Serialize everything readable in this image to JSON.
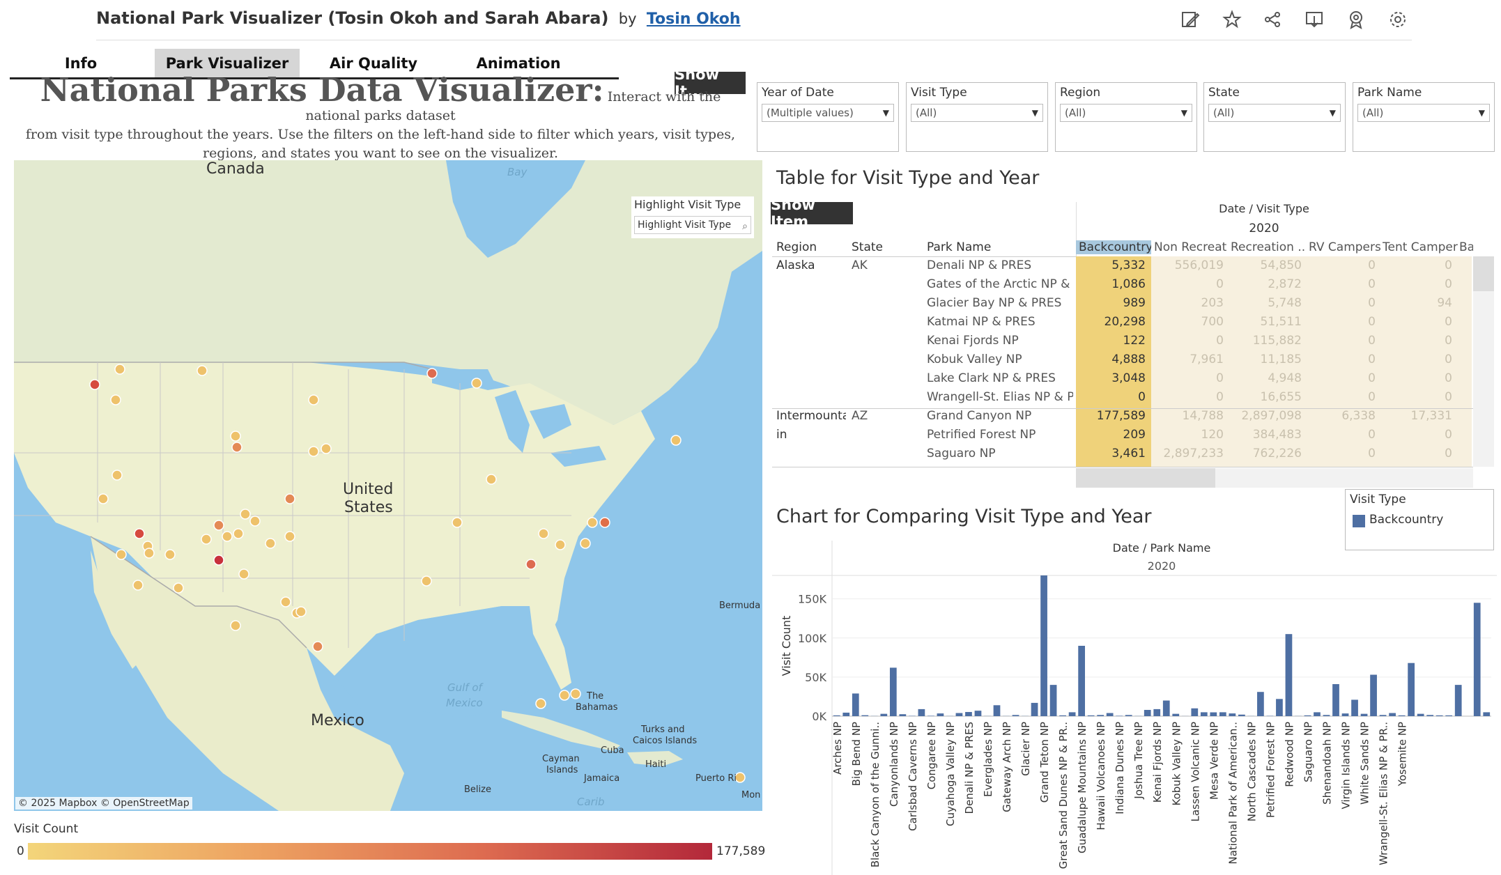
{
  "header": {
    "title": "National Park Visualizer (Tosin Okoh and Sarah Abara)",
    "by": "by",
    "author": "Tosin Okoh"
  },
  "toolbar_icons": [
    "edit-icon",
    "star-icon",
    "share-icon",
    "download-icon",
    "badge-icon",
    "gear-icon"
  ],
  "tabs": [
    {
      "label": "Info",
      "active": false
    },
    {
      "label": "Park Visualizer",
      "active": true
    },
    {
      "label": "Air Quality",
      "active": false
    },
    {
      "label": "Animation",
      "active": false
    }
  ],
  "show_it_label": "Show It...",
  "heading": {
    "big": "National Parks Data Visualizer:",
    "small_inline": "Interact with the national parks dataset",
    "small_rest": "from visit type throughout the years. Use the filters on the left-hand side to filter which years, visit types, regions, and states you want to see on the visualizer."
  },
  "filters": [
    {
      "label": "Year of Date",
      "value": "(Multiple values)"
    },
    {
      "label": "Visit Type",
      "value": "(All)"
    },
    {
      "label": "Region",
      "value": "(All)"
    },
    {
      "label": "State",
      "value": "(All)"
    },
    {
      "label": "Park Name",
      "value": "(All)"
    }
  ],
  "map": {
    "labels": {
      "canada": "Canada",
      "us1": "United",
      "us2": "States",
      "mexico": "Mexico",
      "bay": "Bay",
      "gulf1": "Gulf of",
      "gulf2": "Mexico",
      "bermuda": "Bermuda",
      "bahamas1": "The",
      "bahamas2": "Bahamas",
      "turks1": "Turks and",
      "turks2": "Caicos Islands",
      "cuba": "Cuba",
      "cayman1": "Cayman",
      "cayman2": "Islands",
      "haiti": "Haiti",
      "puerto": "Puerto Ri",
      "jamaica": "Jamaica",
      "belize": "Belize",
      "caribbean": "Carib",
      "mon": "Mon"
    },
    "attribution": "© 2025 Mapbox © OpenStreetMap",
    "highlight": {
      "title": "Highlight Visit Type",
      "placeholder": "Highlight Visit Type"
    }
  },
  "visit_count_legend": {
    "title": "Visit Count",
    "min": "0",
    "max": "177,589"
  },
  "table": {
    "title": "Table for Visit Type and Year",
    "show_item": "Show Item",
    "header_group": "Date / Visit Type",
    "year": "2020",
    "columns": {
      "region": "Region",
      "state": "State",
      "park": "Park Name",
      "backcountry": "Backcountry",
      "non_rec": "Non Recreat..",
      "rec": "Recreation ..",
      "rv": "RV Campers",
      "tent": "Tent Campers",
      "ba": "Ba"
    },
    "rows": [
      {
        "region": "Alaska",
        "state": "AK",
        "park": "Denali NP & PRES",
        "bc": "5,332",
        "nr": "556,019",
        "rec": "54,850",
        "rv": "0",
        "tent": "0"
      },
      {
        "region": "",
        "state": "",
        "park": "Gates of the Arctic NP & P..",
        "bc": "1,086",
        "nr": "0",
        "rec": "2,872",
        "rv": "0",
        "tent": "0"
      },
      {
        "region": "",
        "state": "",
        "park": "Glacier Bay NP & PRES",
        "bc": "989",
        "nr": "203",
        "rec": "5,748",
        "rv": "0",
        "tent": "94"
      },
      {
        "region": "",
        "state": "",
        "park": "Katmai NP & PRES",
        "bc": "20,298",
        "nr": "700",
        "rec": "51,511",
        "rv": "0",
        "tent": "0"
      },
      {
        "region": "",
        "state": "",
        "park": "Kenai Fjords NP",
        "bc": "122",
        "nr": "0",
        "rec": "115,882",
        "rv": "0",
        "tent": "0"
      },
      {
        "region": "",
        "state": "",
        "park": "Kobuk Valley NP",
        "bc": "4,888",
        "nr": "7,961",
        "rec": "11,185",
        "rv": "0",
        "tent": "0"
      },
      {
        "region": "",
        "state": "",
        "park": "Lake Clark NP & PRES",
        "bc": "3,048",
        "nr": "0",
        "rec": "4,948",
        "rv": "0",
        "tent": "0"
      },
      {
        "region": "",
        "state": "",
        "park": "Wrangell-St. Elias NP & PR..",
        "bc": "0",
        "nr": "0",
        "rec": "16,655",
        "rv": "0",
        "tent": "0"
      },
      {
        "region": "Intermounta",
        "state": "AZ",
        "park": "Grand Canyon NP",
        "bc": "177,589",
        "nr": "14,788",
        "rec": "2,897,098",
        "rv": "6,338",
        "tent": "17,331"
      },
      {
        "region": "in",
        "state": "",
        "park": "Petrified Forest NP",
        "bc": "209",
        "nr": "120",
        "rec": "384,483",
        "rv": "0",
        "tent": "0"
      },
      {
        "region": "",
        "state": "",
        "park": "Saguaro NP",
        "bc": "3,461",
        "nr": "2,897,233",
        "rec": "762,226",
        "rv": "0",
        "tent": "0"
      }
    ]
  },
  "legend": {
    "title": "Visit Type",
    "item": "Backcountry",
    "color": "#4e6fa3"
  },
  "chart_title": "Chart for Comparing Visit Type and Year",
  "chart_data": {
    "type": "bar",
    "title": "Chart for Comparing Visit Type and Year",
    "group_header": "Date / Park Name",
    "group": "2020",
    "ylabel": "Visit Count",
    "ylim": [
      0,
      180000
    ],
    "yticks": [
      {
        "v": 0,
        "label": "0K"
      },
      {
        "v": 50000,
        "label": "50K"
      },
      {
        "v": 100000,
        "label": "100K"
      },
      {
        "v": 150000,
        "label": "150K"
      }
    ],
    "series": [
      {
        "name": "Backcountry",
        "color": "#4e6fa3"
      }
    ],
    "categories": [
      "Arches NP",
      "",
      "Big Bend NP",
      "",
      "Black Canyon of the Gunni..",
      "",
      "Canyonlands NP",
      "",
      "Carlsbad Caverns NP",
      "",
      "Congaree NP",
      "",
      "Cuyahoga Valley NP",
      "",
      "Denali NP & PRES",
      "",
      "Everglades NP",
      "",
      "Gateway Arch NP",
      "",
      "Glacier NP",
      "",
      "Grand Teton NP",
      "",
      "Great Sand Dunes NP & PR..",
      "",
      "Guadalupe Mountains NP",
      "",
      "Hawaii Volcanoes NP",
      "",
      "Indiana Dunes NP",
      "",
      "Joshua Tree NP",
      "",
      "Kenai Fjords NP",
      "",
      "Kobuk Valley NP",
      "",
      "Lassen Volcanic NP",
      "",
      "Mesa Verde NP",
      "",
      "National Park of American..",
      "",
      "North Cascades NP",
      "",
      "Petrified Forest NP",
      "",
      "Redwood NP",
      "",
      "Saguaro NP",
      "",
      "Shenandoah NP",
      "",
      "Virgin Islands NP",
      "",
      "White Sands NP",
      "",
      "Wrangell-St. Elias NP & PR..",
      "",
      "Yosemite NP",
      ""
    ],
    "values": [
      1000,
      4500,
      29000,
      1200,
      200,
      3000,
      62000,
      2500,
      400,
      9000,
      500,
      3500,
      200,
      4000,
      5332,
      7000,
      200,
      14000,
      200,
      1500,
      200,
      17000,
      180000,
      40000,
      1000,
      5000,
      90000,
      1000,
      1500,
      4000,
      500,
      1500,
      200,
      8000,
      9000,
      20000,
      3000,
      122,
      10000,
      5000,
      4888,
      5000,
      3500,
      2000,
      200,
      31000,
      400,
      22000,
      105000,
      209,
      1000,
      5000,
      1500,
      41000,
      3461,
      21000,
      3000,
      53000,
      1500,
      4000,
      1000,
      68000,
      3000,
      1500,
      1000,
      1000,
      40000,
      0,
      145000,
      5000
    ]
  }
}
